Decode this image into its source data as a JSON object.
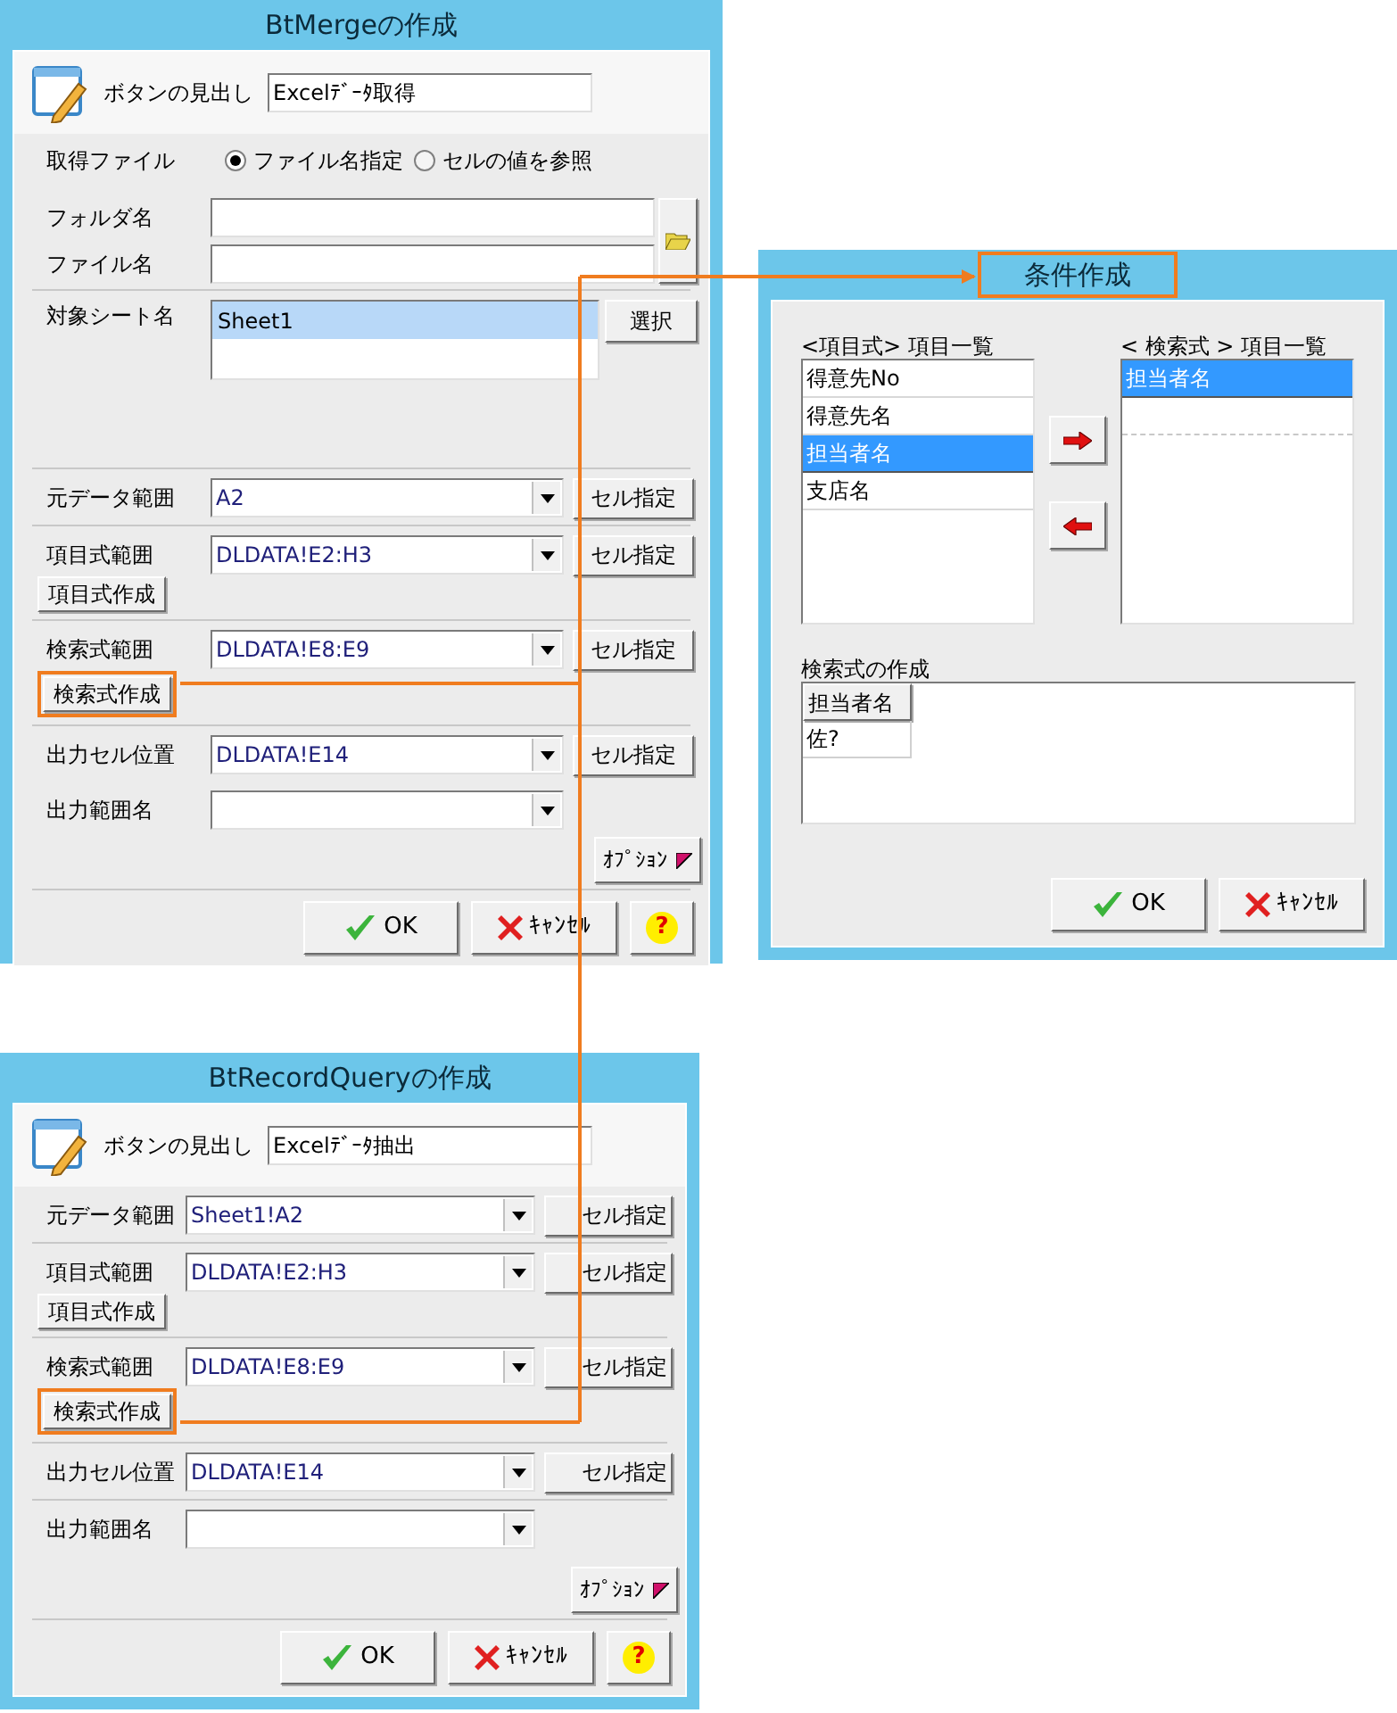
{
  "merge_dialog": {
    "title": "BtMergeの作成",
    "title_highlighted": false,
    "caption": {
      "label": "ボタンの見出し",
      "value": "Excelﾃﾞｰﾀ取得"
    },
    "source_file": {
      "label": "取得ファイル",
      "options": [
        {
          "label": "ファイル名指定",
          "selected": true
        },
        {
          "label": "セルの値を参照",
          "selected": false
        }
      ]
    },
    "folder_label": "フォルダ名",
    "file_label": "ファイル名",
    "sheet": {
      "label": "対象シート名",
      "items": [
        {
          "label": "Sheet1",
          "selected": true
        }
      ],
      "button": "選択"
    },
    "ranges": [
      {
        "label": "元データ範囲",
        "value": "A2",
        "button": "セル指定",
        "divider": true
      },
      {
        "label": "項目式範囲",
        "value": "DLDATA!E2:H3",
        "button": "セル指定",
        "sub_button": {
          "label": "項目式作成",
          "highlighted": false
        },
        "divider": true
      },
      {
        "label": "検索式範囲",
        "value": "DLDATA!E8:E9",
        "button": "セル指定",
        "sub_button": {
          "label": "検索式作成",
          "highlighted": true
        },
        "divider": true
      },
      {
        "label": "出力セル位置",
        "value": "DLDATA!E14",
        "button": "セル指定",
        "divider": false
      },
      {
        "label": "出力範囲名",
        "divider": false
      }
    ],
    "option_button": "ｵﾌﾟｼｮﾝ",
    "buttons": [
      {
        "kind": "ok",
        "label": "OK"
      },
      {
        "kind": "cancel",
        "label": "ｷｬﾝｾﾙ"
      },
      {
        "kind": "help",
        "label": "?"
      }
    ]
  },
  "condition_dialog": {
    "title": "条件作成",
    "title_highlighted": true,
    "left_list": {
      "heading": "<項目式> 項目一覧",
      "items": [
        {
          "label": "得意先No",
          "selected": false
        },
        {
          "label": "得意先名",
          "selected": false
        },
        {
          "label": "担当者名",
          "selected": true
        },
        {
          "label": "支店名",
          "selected": false
        }
      ]
    },
    "right_list": {
      "heading": "< 検索式 > 項目一覧",
      "items": [
        {
          "label": "担当者名",
          "selected": true
        }
      ]
    },
    "grid": {
      "heading": "検索式の作成",
      "columns": [
        "担当者名"
      ],
      "rows": [
        [
          "佐?"
        ]
      ]
    },
    "buttons": [
      {
        "kind": "ok",
        "label": "OK"
      },
      {
        "kind": "cancel",
        "label": "ｷｬﾝｾﾙ"
      }
    ]
  },
  "record_query_dialog": {
    "title": "BtRecordQueryの作成",
    "title_highlighted": false,
    "caption": {
      "label": "ボタンの見出し",
      "value": "Excelﾃﾞｰﾀ抽出"
    },
    "ranges": [
      {
        "label": "元データ範囲",
        "value": "Sheet1!A2",
        "button": "セル指定",
        "divider": true
      },
      {
        "label": "項目式範囲",
        "value": "DLDATA!E2:H3",
        "button": "セル指定",
        "sub_button": {
          "label": "項目式作成",
          "highlighted": false
        },
        "divider": true
      },
      {
        "label": "検索式範囲",
        "value": "DLDATA!E8:E9",
        "button": "セル指定",
        "sub_button": {
          "label": "検索式作成",
          "highlighted": true
        },
        "divider": true
      },
      {
        "label": "出力セル位置",
        "value": "DLDATA!E14",
        "button": "セル指定",
        "divider": true
      },
      {
        "label": "出力範囲名",
        "divider": false
      }
    ],
    "option_button": "ｵﾌﾟｼｮﾝ",
    "buttons": [
      {
        "kind": "ok",
        "label": "OK"
      },
      {
        "kind": "cancel",
        "label": "ｷｬﾝｾﾙ"
      },
      {
        "kind": "help",
        "label": "?"
      }
    ]
  }
}
